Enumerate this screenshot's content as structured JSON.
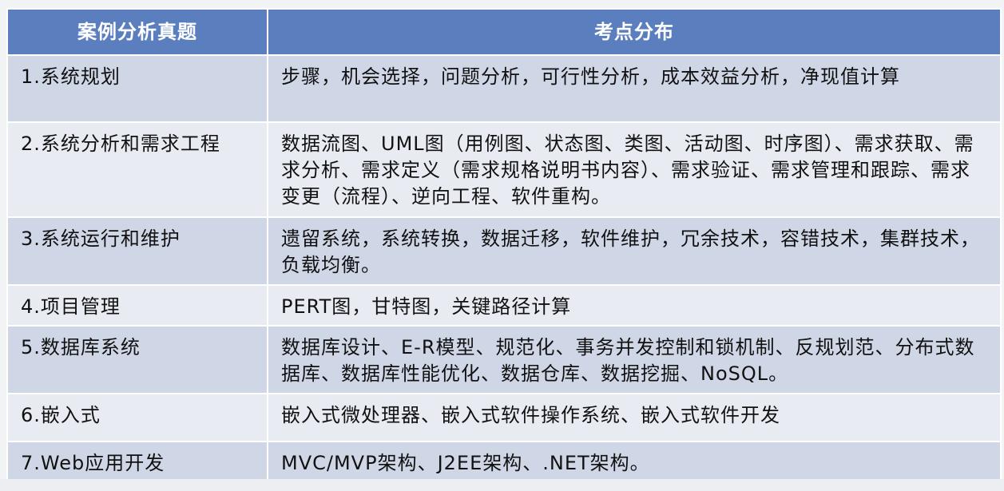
{
  "header": {
    "col1": "案例分析真题",
    "col2": "考点分布"
  },
  "rows": [
    {
      "topic": "1.系统规划",
      "points": "步骤，机会选择，问题分析，可行性分析，成本效益分析，净现值计算"
    },
    {
      "topic": "2.系统分析和需求工程",
      "points": "数据流图、UML图（用例图、状态图、类图、活动图、时序图）、需求获取、需求分析、需求定义（需求规格说明书内容）、需求验证、需求管理和跟踪、需求变更（流程）、逆向工程、软件重构。"
    },
    {
      "topic": "3.系统运行和维护",
      "points": "遗留系统，系统转换，数据迁移，软件维护，冗余技术，容错技术，集群技术，负载均衡。"
    },
    {
      "topic": "4.项目管理",
      "points": "PERT图，甘特图，关键路径计算"
    },
    {
      "topic": "5.数据库系统",
      "points": "数据库设计、E-R模型、规范化、事务并发控制和锁机制、反规划范、分布式数据库、数据库性能优化、数据仓库、数据挖掘、NoSQL。"
    },
    {
      "topic": "6.嵌入式",
      "points": "嵌入式微处理器、嵌入式软件操作系统、嵌入式软件开发"
    },
    {
      "topic": "7.Web应用开发",
      "points": "MVC/MVP架构、J2EE架构、.NET架构。"
    }
  ]
}
